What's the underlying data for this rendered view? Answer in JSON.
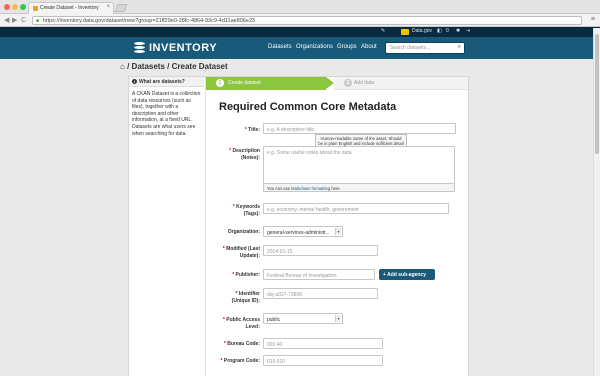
{
  "browser": {
    "tab_title": "Create Dataset - Inventory",
    "tab_close": "×",
    "url": "https://inventory.data.gov/dataset/new?group=21ff29e0-28fc-4864-93c9-4d11ae806e23",
    "back": "◀",
    "forward": "▶",
    "reload": "C",
    "menu_glyph": "≡",
    "traffic_colors": [
      "#fc605c",
      "#fdbc40",
      "#34c84a"
    ]
  },
  "account_bar": {
    "wrench_glyph": "✎",
    "org_name": "Data.gov",
    "notifications": "0",
    "settings_glyph": "✱",
    "logout_glyph": "⇥"
  },
  "masthead": {
    "logo_text": "INVENTORY",
    "nav": [
      "Datasets",
      "Organizations",
      "Groups",
      "About"
    ],
    "search_placeholder": "Search datasets...",
    "search_glyph": "⌕"
  },
  "breadcrumb": {
    "home_glyph": "⌂",
    "sep": "/",
    "items": [
      "Datasets",
      "Create Dataset"
    ]
  },
  "sidebar": {
    "heading": "What are datasets?",
    "info_glyph": "i",
    "body": "A CKAN Dataset is a collection of data resources (such as files), together with a description and other information, at a fixed URL. Datasets are what users see when searching for data."
  },
  "stages": [
    {
      "num": "1",
      "label": "Create dataset",
      "active": true
    },
    {
      "num": "2",
      "label": "Add data",
      "active": false
    }
  ],
  "form": {
    "title": "Required Common Core Metadata",
    "required_mark": "*",
    "fields": {
      "title": {
        "label": "Title:",
        "placeholder": "e.g. A descriptive title"
      },
      "description": {
        "label_line1": "Description",
        "label_line2": "(Notes):",
        "placeholder": "e.g. Some useful notes about the data",
        "footer_pre": "You can use",
        "footer_link": "Markdown formatting",
        "footer_post": "here"
      },
      "keywords": {
        "label_line1": "Keywords",
        "label_line2": "(Tags):",
        "placeholder": "e.g. economy, mental health, government"
      },
      "organization": {
        "label": "Organization:",
        "value": "general-services-administr..."
      },
      "modified": {
        "label_line1": "Modified (Last",
        "label_line2": "Update):",
        "value": "2014-01-15"
      },
      "publisher": {
        "label": "Publisher:",
        "value": "Federal Bureau of Investigation"
      },
      "identifier": {
        "label_line1": "Identifier",
        "label_line2": "(Unique ID):",
        "value": "doj-a327-73808"
      },
      "access_level": {
        "label_line1": "Public Access",
        "label_line2": "Level:",
        "value": "public"
      },
      "bureau_code": {
        "label": "Bureau Code:",
        "value": "001:40"
      },
      "program_code": {
        "label": "Program Code:",
        "value": "015:010"
      }
    },
    "tooltip": "Human-readable name of the asset. Should be in plain English and include sufficient detail to facilitate search and discovery.",
    "add_subagency_label": "Add sub-agency",
    "add_glyph": "+",
    "select_glyph": "▾"
  }
}
